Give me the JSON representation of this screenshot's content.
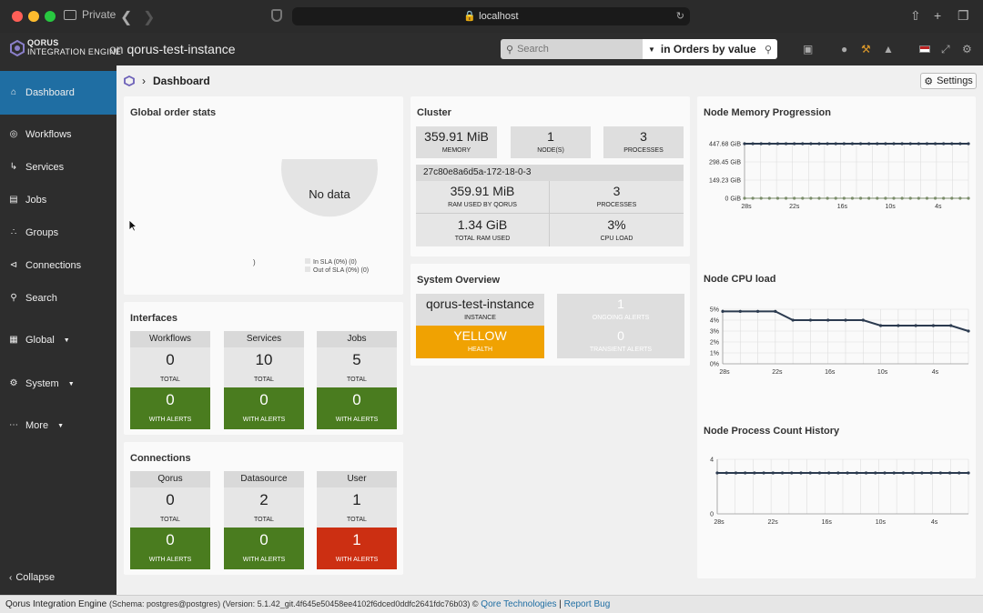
{
  "browser": {
    "private_label": "Private",
    "url": "localhost"
  },
  "app": {
    "logo_line1": "QORUS",
    "logo_line2": "INTEGRATION ENGINE",
    "on": "on",
    "instance": "qorus-test-instance",
    "search_placeholder": "Search",
    "search_mode": "in Orders by value"
  },
  "sidebar": {
    "items": [
      {
        "label": "Dashboard",
        "icon": "home-icon"
      },
      {
        "label": "Workflows",
        "icon": "workflow-icon"
      },
      {
        "label": "Services",
        "icon": "services-icon"
      },
      {
        "label": "Jobs",
        "icon": "calendar-icon"
      },
      {
        "label": "Groups",
        "icon": "groups-icon"
      },
      {
        "label": "Connections",
        "icon": "share-icon"
      },
      {
        "label": "Search",
        "icon": "search-icon"
      },
      {
        "label": "Global",
        "icon": "grid-icon"
      },
      {
        "label": "System",
        "icon": "gear-icon"
      },
      {
        "label": "More",
        "icon": "more-icon"
      }
    ],
    "collapse": "Collapse"
  },
  "page": {
    "title": "Dashboard",
    "settings": "Settings"
  },
  "order_stats": {
    "title": "Global order stats",
    "no_data": "No data",
    "legend": [
      "In SLA (0%) (0)",
      "Out of SLA (0%) (0)"
    ],
    "stray": ")"
  },
  "interfaces": {
    "title": "Interfaces",
    "total_label": "TOTAL",
    "alerts_label": "WITH ALERTS",
    "items": [
      {
        "name": "Workflows",
        "total": "0",
        "alerts": "0"
      },
      {
        "name": "Services",
        "total": "10",
        "alerts": "0"
      },
      {
        "name": "Jobs",
        "total": "5",
        "alerts": "0"
      }
    ]
  },
  "connections": {
    "title": "Connections",
    "total_label": "TOTAL",
    "alerts_label": "WITH ALERTS",
    "items": [
      {
        "name": "Qorus",
        "total": "0",
        "alerts": "0"
      },
      {
        "name": "Datasource",
        "total": "2",
        "alerts": "0"
      },
      {
        "name": "User",
        "total": "1",
        "alerts": "1"
      }
    ]
  },
  "cluster": {
    "title": "Cluster",
    "memory": "359.91 MiB",
    "memory_label": "MEMORY",
    "nodes": "1",
    "nodes_label": "NODE(S)",
    "processes": "3",
    "processes_label": "PROCESSES",
    "node_name": "27c80e8a6d5a-172-18-0-3",
    "ram_qorus": "359.91 MiB",
    "ram_qorus_label": "RAM USED BY QORUS",
    "node_processes": "3",
    "node_processes_label": "PROCESSES",
    "total_ram": "1.34 GiB",
    "total_ram_label": "TOTAL RAM USED",
    "cpu": "3%",
    "cpu_label": "CPU LOAD"
  },
  "overview": {
    "title": "System Overview",
    "instance": "qorus-test-instance",
    "instance_label": "INSTANCE",
    "ongoing": "1",
    "ongoing_label": "ONGOING ALERTS",
    "health": "YELLOW",
    "health_label": "HEALTH",
    "transient": "0",
    "transient_label": "TRANSIENT ALERTS"
  },
  "mem_chart": {
    "title": "Node Memory Progression",
    "yticks": [
      "447.68 GiB",
      "298.45 GiB",
      "149.23 GiB",
      "0 GiB"
    ],
    "xticks": [
      "28s",
      "22s",
      "16s",
      "10s",
      "4s"
    ]
  },
  "cpu_chart": {
    "title": "Node CPU load",
    "yticks": [
      "5%",
      "4%",
      "3%",
      "2%",
      "1%",
      "0%"
    ],
    "xticks": [
      "28s",
      "22s",
      "16s",
      "10s",
      "4s"
    ]
  },
  "proc_chart": {
    "title": "Node Process Count History",
    "yticks": [
      "4",
      "0"
    ],
    "xticks": [
      "28s",
      "22s",
      "16s",
      "10s",
      "4s"
    ]
  },
  "chart_data": [
    {
      "type": "line",
      "title": "Node Memory Progression",
      "x": [
        "28s",
        "27s",
        "26s",
        "25s",
        "24s",
        "23s",
        "22s",
        "21s",
        "20s",
        "19s",
        "18s",
        "17s",
        "16s",
        "15s",
        "14s",
        "13s",
        "12s",
        "11s",
        "10s",
        "9s",
        "8s",
        "7s",
        "6s",
        "5s",
        "4s",
        "3s",
        "2s",
        "1s"
      ],
      "series": [
        {
          "values": [
            447.68,
            447.68,
            447.68,
            447.68,
            447.68,
            447.68,
            447.68,
            447.68,
            447.68,
            447.68,
            447.68,
            447.68,
            447.68,
            447.68,
            447.68,
            447.68,
            447.68,
            447.68,
            447.68,
            447.68,
            447.68,
            447.68,
            447.68,
            447.68,
            447.68,
            447.68,
            447.68,
            447.68
          ]
        },
        {
          "values": [
            0,
            0,
            0,
            0,
            0,
            0,
            0,
            0,
            0,
            0,
            0,
            0,
            0,
            0,
            0,
            0,
            0,
            0,
            0,
            0,
            0,
            0,
            0,
            0,
            0,
            0,
            0,
            0
          ]
        }
      ],
      "ylim": [
        0,
        447.68
      ]
    },
    {
      "type": "line",
      "title": "Node CPU load",
      "x": [
        "28s",
        "26s",
        "24s",
        "22s",
        "20s",
        "18s",
        "16s",
        "14s",
        "12s",
        "10s",
        "8s",
        "6s",
        "4s",
        "2s",
        "0s"
      ],
      "series": [
        {
          "values": [
            4.8,
            4.8,
            4.8,
            4.8,
            4.0,
            4.0,
            4.0,
            4.0,
            4.0,
            3.5,
            3.5,
            3.5,
            3.5,
            3.5,
            3.0
          ]
        }
      ],
      "ylim": [
        0,
        5
      ]
    },
    {
      "type": "line",
      "title": "Node Process Count History",
      "x": [
        "28s",
        "27s",
        "26s",
        "25s",
        "24s",
        "23s",
        "22s",
        "21s",
        "20s",
        "19s",
        "18s",
        "17s",
        "16s",
        "15s",
        "14s",
        "13s",
        "12s",
        "11s",
        "10s",
        "9s",
        "8s",
        "7s",
        "6s",
        "5s",
        "4s",
        "3s",
        "2s",
        "1s"
      ],
      "series": [
        {
          "values": [
            3,
            3,
            3,
            3,
            3,
            3,
            3,
            3,
            3,
            3,
            3,
            3,
            3,
            3,
            3,
            3,
            3,
            3,
            3,
            3,
            3,
            3,
            3,
            3,
            3,
            3,
            3,
            3
          ]
        }
      ],
      "ylim": [
        0,
        4
      ]
    }
  ],
  "footer": {
    "product": "Qorus Integration Engine",
    "meta": "(Schema: postgres@postgres) (Version: 5.1.42_git.4f645e50458ee4102f6dced0ddfc2641fdc76b03) ©",
    "company": "Qore Technologies",
    "sep": "|",
    "report": "Report Bug"
  }
}
